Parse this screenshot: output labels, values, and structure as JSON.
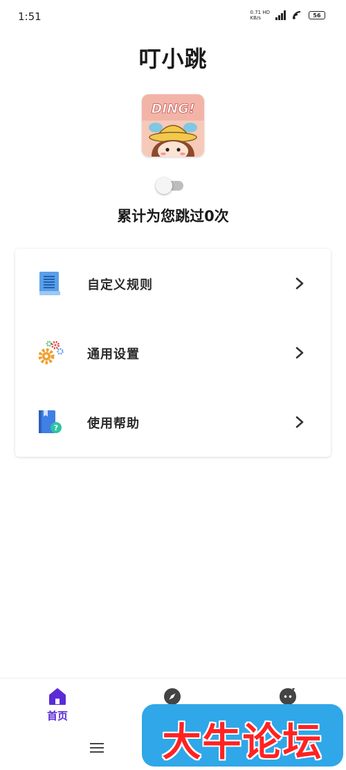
{
  "status_bar": {
    "time": "1:51",
    "net_speed_value": "0.71",
    "net_speed_unit": "KB/s",
    "network_type": "HD",
    "battery": "56"
  },
  "app": {
    "title": "叮小跳",
    "logo_text": "DING!"
  },
  "toggle": {
    "enabled": false
  },
  "skip_count_text": "累计为您跳过0次",
  "menu": {
    "items": [
      {
        "label": "自定义规则",
        "icon": "document-list-icon"
      },
      {
        "label": "通用设置",
        "icon": "gears-icon"
      },
      {
        "label": "使用帮助",
        "icon": "help-book-icon"
      }
    ]
  },
  "bottom_nav": {
    "items": [
      {
        "label": "首页",
        "icon": "home-icon",
        "active": true
      },
      {
        "label": "",
        "icon": "compass-icon",
        "active": false
      },
      {
        "label": "",
        "icon": "chat-bubble-icon",
        "active": false
      }
    ]
  },
  "watermark": {
    "text": "大牛论坛"
  },
  "colors": {
    "accent": "#5b2bd6",
    "nav_inactive": "#444444",
    "watermark_bg": "#2fa7e8",
    "watermark_text": "#ff2222"
  }
}
